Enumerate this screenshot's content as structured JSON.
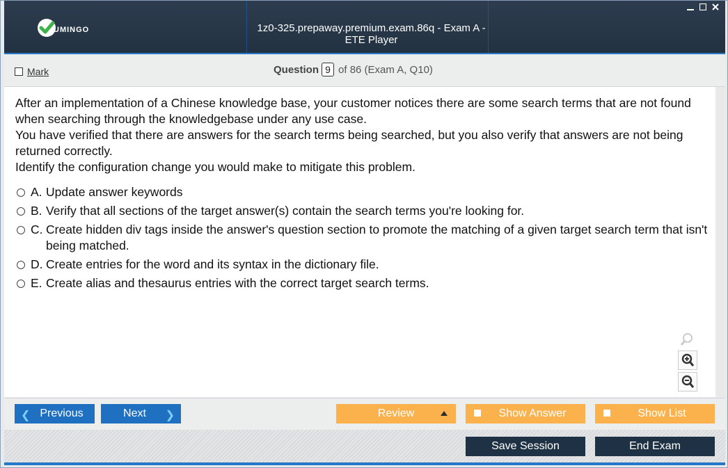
{
  "app": {
    "brand": "UMINGO",
    "window_title": "1z0-325.prepaway.premium.exam.86q - Exam A - ETE Player",
    "accent_color": "#2478c7"
  },
  "window_controls": [
    "minimize-icon",
    "maximize-icon",
    "close-icon"
  ],
  "header": {
    "mark_label": "Mark",
    "question_label": "Question",
    "question_number": "9",
    "question_of": "of 86 (Exam A, Q10)"
  },
  "question": {
    "paragraphs": [
      "After an implementation of a Chinese knowledge base, your customer notices there are some search terms that are not found when searching through the knowledgebase under any use case.",
      "You have verified that there are answers for the search terms being searched, but you also verify that answers are not being returned correctly.",
      "Identify the configuration change you would make to mitigate this problem."
    ],
    "answers": [
      {
        "letter": "A.",
        "text": "Update answer keywords"
      },
      {
        "letter": "B.",
        "text": "Verify that all sections of the target answer(s) contain the search terms you're looking for."
      },
      {
        "letter": "C.",
        "text": "Create hidden div tags inside the answer's question section to promote the matching of a given target search term that isn't being matched."
      },
      {
        "letter": "D.",
        "text": "Create entries for the word and its syntax in the dictionary file."
      },
      {
        "letter": "E.",
        "text": "Create alias and thesaurus entries with the correct target search terms."
      }
    ]
  },
  "zoom_icons": [
    "search-icon",
    "zoom-in-icon",
    "zoom-out-icon"
  ],
  "nav": {
    "previous": "Previous",
    "next": "Next",
    "review": "Review",
    "show_answer": "Show Answer",
    "show_list": "Show List",
    "save_session": "Save Session",
    "end_exam": "End Exam"
  },
  "colors": {
    "nav_blue": "#1f70c1",
    "nav_orange": "#fbb24c",
    "bottom_dark": "#1f3144",
    "titlebar": "#2d3d4f"
  }
}
